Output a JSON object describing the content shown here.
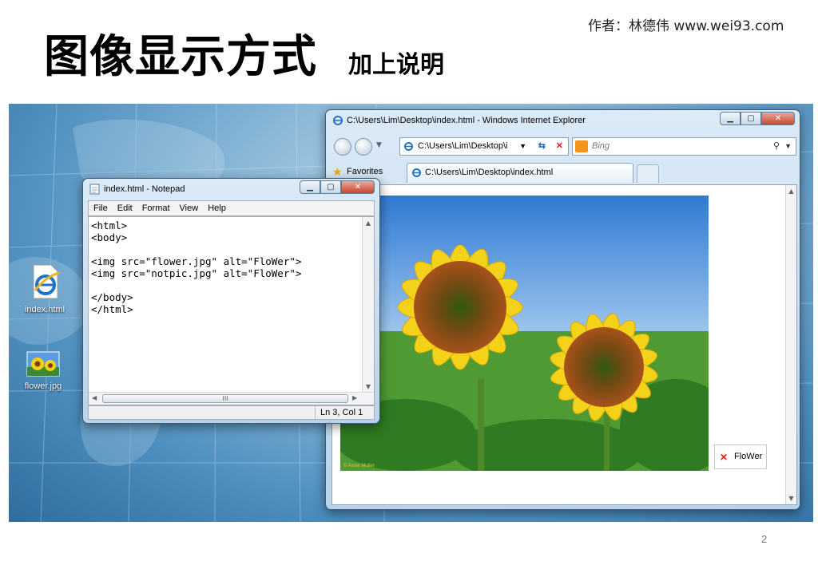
{
  "slide": {
    "title": "图像显示方式",
    "subtitle": "加上说明",
    "author": "作者：林德伟 www.wei93.com",
    "page_number": "2"
  },
  "desktop": {
    "icons": [
      {
        "label": "index.html",
        "icon": "ie-file-icon"
      },
      {
        "label": "flower.jpg",
        "icon": "image-file-icon"
      }
    ]
  },
  "ie_window": {
    "title": "C:\\Users\\Lim\\Desktop\\index.html - Windows Internet Explorer",
    "address": "C:\\Users\\Lim\\Desktop\\i",
    "search_placeholder": "Bing",
    "favorites_label": "Favorites",
    "tab_label": "C:\\Users\\Lim\\Desktop\\index.html",
    "broken_image_alt": "FloWer",
    "photo_credit": "© Ansel Muller"
  },
  "notepad": {
    "title": "index.html - Notepad",
    "menu": [
      "File",
      "Edit",
      "Format",
      "View",
      "Help"
    ],
    "code": "<html>\n<body>\n\n<img src=\"flower.jpg\" alt=\"FloWer\">\n<img src=\"notpic.jpg\" alt=\"FloWer\">\n\n</body>\n</html>",
    "status": "Ln 3, Col 1",
    "hscroll_grip": "III"
  },
  "colors": {
    "desktop_blue": "#4d8fbf",
    "sunflower_petal": "#f5d21a",
    "sunflower_center": "#8a4a16",
    "sky": "#3f86d6"
  }
}
